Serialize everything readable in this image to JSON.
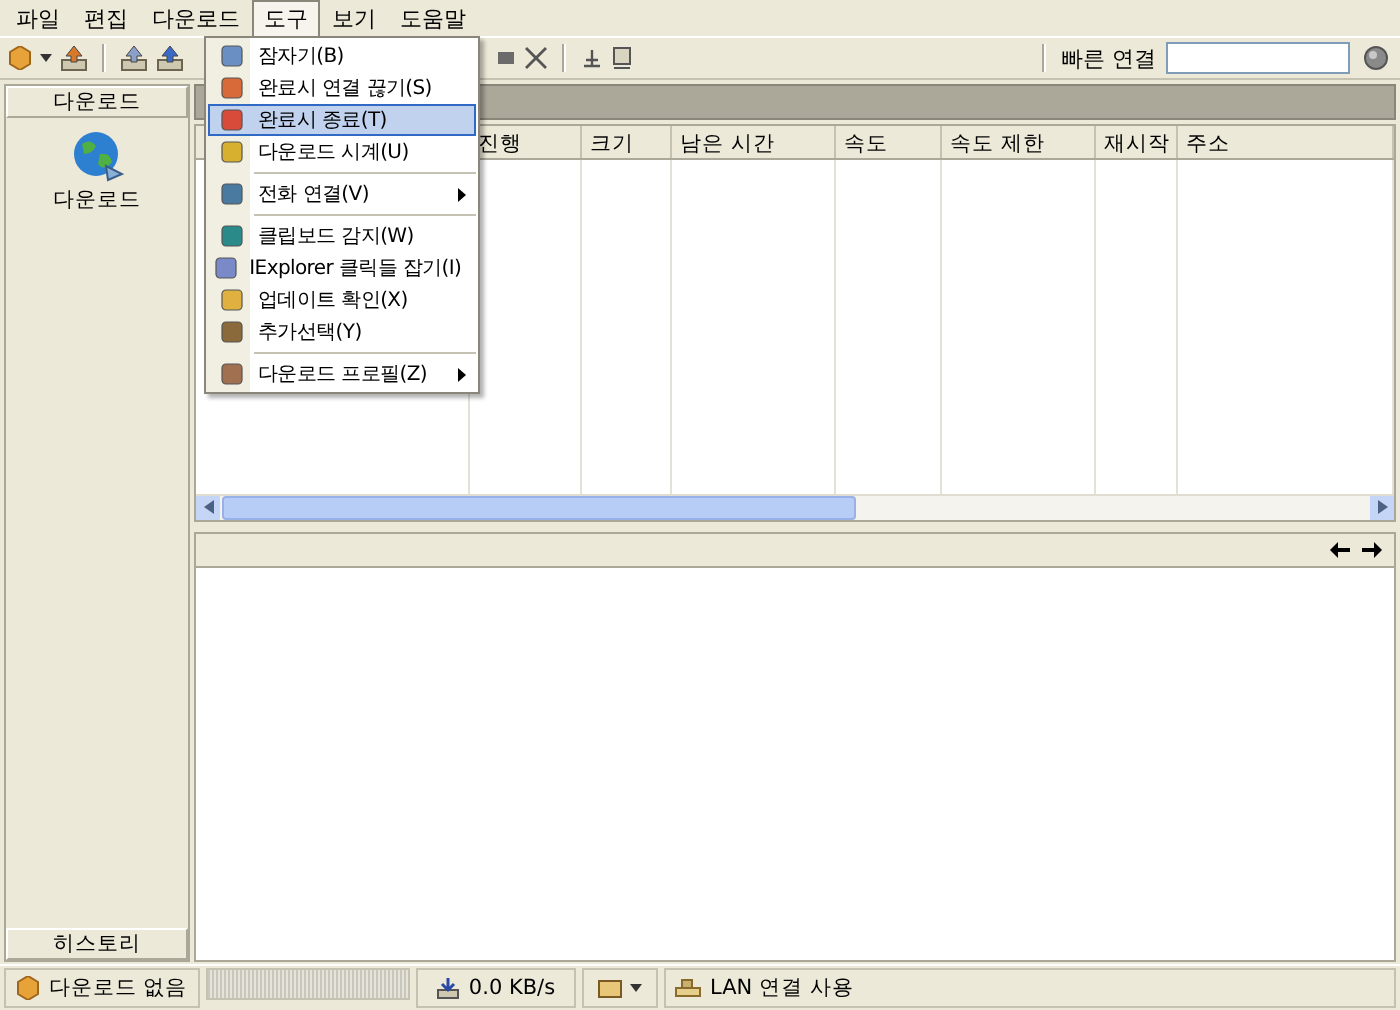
{
  "menu_bar": [
    {
      "label": "파일",
      "selected": false
    },
    {
      "label": "편집",
      "selected": false
    },
    {
      "label": "다운로드",
      "selected": false
    },
    {
      "label": "도구",
      "selected": true
    },
    {
      "label": "보기",
      "selected": false
    },
    {
      "label": "도움말",
      "selected": false
    }
  ],
  "tools_menu": [
    {
      "kind": "item",
      "label": "잠자기(B)",
      "selected": false,
      "submenu": false
    },
    {
      "kind": "item",
      "label": "완료시 연결 끊기(S)",
      "selected": false,
      "submenu": false
    },
    {
      "kind": "item",
      "label": "완료시 종료(T)",
      "selected": true,
      "submenu": false
    },
    {
      "kind": "item",
      "label": "다운로드 시계(U)",
      "selected": false,
      "submenu": false
    },
    {
      "kind": "separator"
    },
    {
      "kind": "item",
      "label": "전화 연결(V)",
      "selected": false,
      "submenu": true
    },
    {
      "kind": "separator"
    },
    {
      "kind": "item",
      "label": "클립보드 감지(W)",
      "selected": false,
      "submenu": false
    },
    {
      "kind": "item",
      "label": "IExplorer 클릭들 잡기(I)",
      "selected": false,
      "submenu": false
    },
    {
      "kind": "item",
      "label": "업데이트 확인(X)",
      "selected": false,
      "submenu": false
    },
    {
      "kind": "item",
      "label": "추가선택(Y)",
      "selected": false,
      "submenu": false
    },
    {
      "kind": "separator"
    },
    {
      "kind": "item",
      "label": "다운로드 프로필(Z)",
      "selected": false,
      "submenu": true
    }
  ],
  "quick_connect": {
    "label": "빠른 연결"
  },
  "sidebar": {
    "header": "다운로드",
    "items": [
      {
        "label": "다운로드"
      }
    ],
    "footer": "히스토리"
  },
  "download_list": {
    "columns": [
      "진행",
      "크기",
      "남은 시간",
      "속도",
      "속도 제한",
      "재시작",
      "주소"
    ]
  },
  "status_bar": {
    "downloads": "다운로드 없음",
    "progress": {
      "level": 0
    },
    "speed": "0.0 KB/s",
    "connection": "LAN 연결 사용"
  }
}
